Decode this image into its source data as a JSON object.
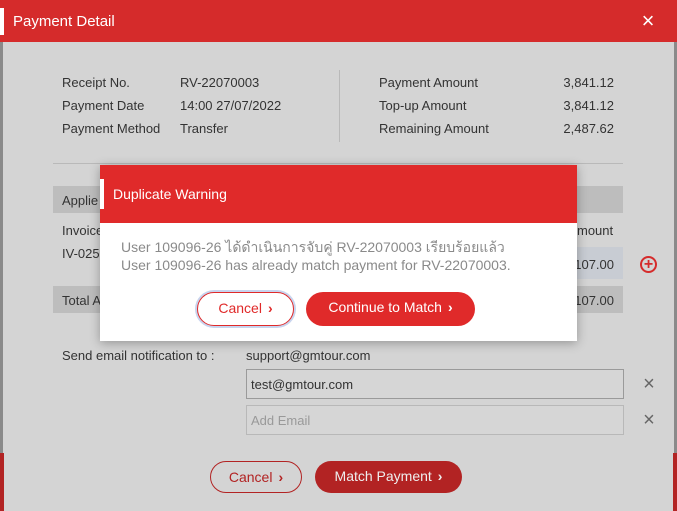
{
  "dialog": {
    "title": "Payment Detail",
    "close_icon": "×"
  },
  "receipt": {
    "receipt_no_label": "Receipt No.",
    "receipt_no_value": "RV-22070003",
    "payment_date_label": "Payment Date",
    "payment_date_value": "14:00 27/07/2022",
    "payment_method_label": "Payment Method",
    "payment_method_value": "Transfer",
    "payment_amount_label": "Payment Amount",
    "payment_amount_value": "3,841.12",
    "topup_amount_label": "Top-up Amount",
    "topup_amount_value": "3,841.12",
    "remaining_amount_label": "Remaining Amount",
    "remaining_amount_value": "2,487.62"
  },
  "applied": {
    "section_label_partial": "Applie",
    "invoice_header_partial": "Invoice",
    "amount_header_partial": "mount",
    "row_invoice_partial": "IV-025",
    "row_amount_partial": "107.00",
    "total_label_partial": "Total A",
    "total_amount_partial": "107.00"
  },
  "email": {
    "label": "Send email notification to :",
    "default_email": "support@gmtour.com",
    "input_value": "test@gmtour.com",
    "add_placeholder": "Add Email"
  },
  "footer": {
    "cancel_label": "Cancel",
    "match_label": "Match Payment"
  },
  "modal": {
    "title": "Duplicate Warning",
    "message_line_1": "User 109096-26 ได้ดำเนินการจับคู่ RV-22070003 เรียบร้อยแล้ว",
    "message_line_2": "User 109096-26 has already match payment for RV-22070003.",
    "cancel_label": "Cancel",
    "continue_label": "Continue to Match"
  },
  "icons": {
    "chevron": "›",
    "plus": "+",
    "x": "×"
  },
  "colors": {
    "header_red": "#d52b2b",
    "modal_red": "#e02a2a",
    "button_red": "#b22323"
  }
}
